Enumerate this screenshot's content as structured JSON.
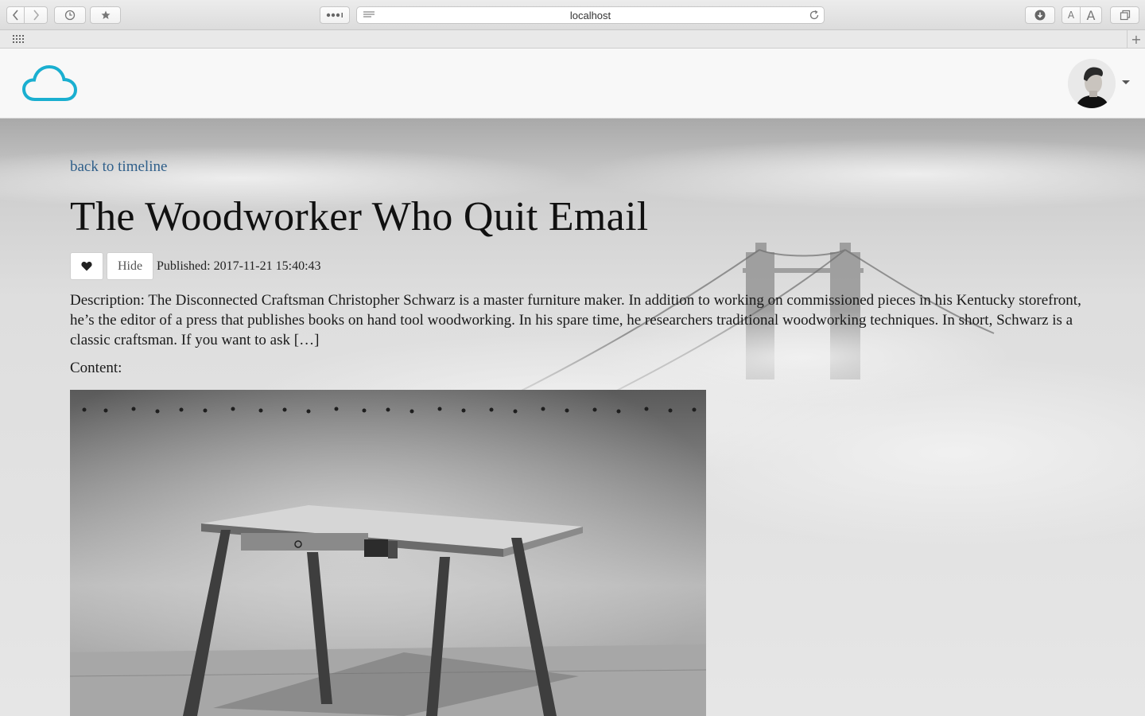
{
  "browser": {
    "url": "localhost",
    "font_small": "A",
    "font_large": "A",
    "new_tab": "+"
  },
  "header": {
    "logo_icon": "cloud-icon",
    "accent_color": "#1aafd0"
  },
  "post": {
    "back_link": "back to timeline",
    "title": "The Woodworker Who Quit Email",
    "hide_label": "Hide",
    "published": "Published: 2017-11-21 15:40:43",
    "description": "Description: The Disconnected Craftsman Christopher Schwarz is a master furniture maker. In addition to working on commissioned pieces in his Kentucky storefront, he’s the editor of a press that publishes books on hand tool woodworking. In his spare time, he researchers traditional woodworking techniques. In short, Schwarz is a classic craftsman. If you want to ask […]",
    "content_label": "Content:"
  }
}
